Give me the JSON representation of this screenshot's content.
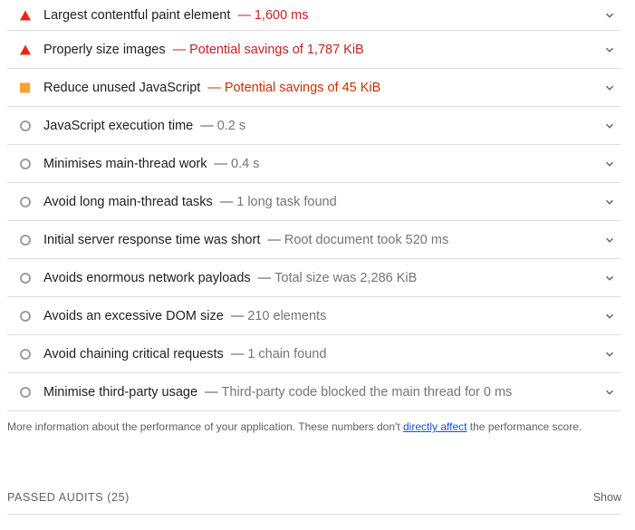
{
  "audits": [
    {
      "status": "fail",
      "title": "Largest contentful paint element",
      "value": "1,600 ms"
    },
    {
      "status": "fail",
      "title": "Properly size images",
      "value": "Potential savings of 1,787 KiB"
    },
    {
      "status": "average",
      "title": "Reduce unused JavaScript",
      "value": "Potential savings of 45 KiB"
    },
    {
      "status": "info",
      "title": "JavaScript execution time",
      "value": "0.2 s"
    },
    {
      "status": "info",
      "title": "Minimises main-thread work",
      "value": "0.4 s"
    },
    {
      "status": "info",
      "title": "Avoid long main-thread tasks",
      "value": "1 long task found"
    },
    {
      "status": "info",
      "title": "Initial server response time was short",
      "value": "Root document took 520 ms"
    },
    {
      "status": "info",
      "title": "Avoids enormous network payloads",
      "value": "Total size was 2,286 KiB"
    },
    {
      "status": "info",
      "title": "Avoids an excessive DOM size",
      "value": "210 elements"
    },
    {
      "status": "info",
      "title": "Avoid chaining critical requests",
      "value": "1 chain found"
    },
    {
      "status": "info",
      "title": "Minimise third-party usage",
      "value": "Third-party code blocked the main thread for 0 ms"
    }
  ],
  "separator": "—",
  "footnote": {
    "before": "More information about the performance of your application. These numbers don't ",
    "link": "directly affect",
    "after": " the performance score."
  },
  "passed": {
    "label": "PASSED AUDITS (25)",
    "show": "Show"
  },
  "colors": {
    "fail": "#e8271a",
    "average": "#f2a331",
    "info": "#9e9e9e",
    "link": "#0b57d0"
  }
}
